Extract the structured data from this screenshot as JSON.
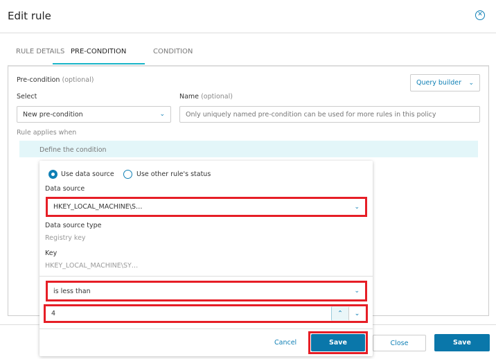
{
  "dialog": {
    "title": "Edit rule",
    "close_icon": "close-circle-icon"
  },
  "tabs": [
    {
      "label": "RULE DETAILS",
      "active": false
    },
    {
      "label": "PRE-CONDITION",
      "active": true
    },
    {
      "label": "CONDITION",
      "active": false
    }
  ],
  "precondition": {
    "label": "Pre-condition",
    "optional": "(optional)",
    "query_builder": "Query builder",
    "select_label": "Select",
    "select_value": "New pre-condition",
    "name_label": "Name",
    "name_optional": "(optional)",
    "name_placeholder": "Only uniquely named pre-condition can be used for more rules in this policy",
    "rule_applies": "Rule applies when",
    "define": "Define the condition"
  },
  "popup": {
    "radio_data_source": "Use data source",
    "radio_other_rule": "Use other rule's status",
    "selected_radio": "Use data source",
    "data_source_label": "Data source",
    "data_source_value": "HKEY_LOCAL_MACHINE\\S…",
    "type_label": "Data source type",
    "type_value": "Registry key",
    "key_label": "Key",
    "key_value": "HKEY_LOCAL_MACHINE\\SY…",
    "operator": "is less than",
    "value": "4",
    "cancel": "Cancel",
    "save": "Save"
  },
  "footer": {
    "close": "Close",
    "save": "Save"
  },
  "colors": {
    "accent": "#0e7fb5",
    "tab_underline": "#1ab5c8",
    "highlight": "#e61e26"
  }
}
